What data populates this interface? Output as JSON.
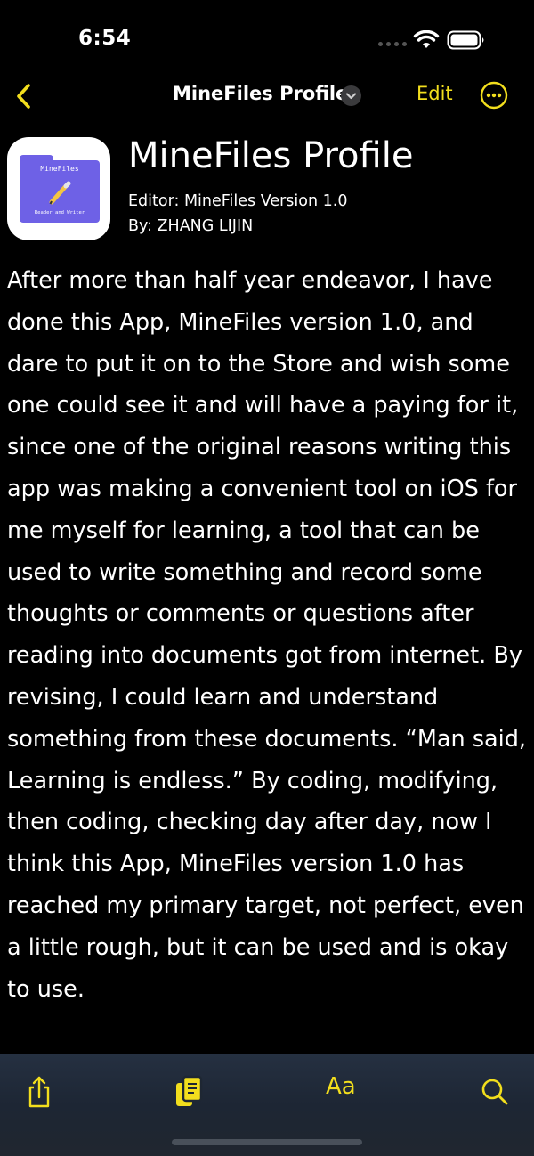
{
  "status": {
    "time": "6:54"
  },
  "nav": {
    "title": "MineFiles Profile",
    "edit_label": "Edit"
  },
  "document": {
    "app_icon": {
      "title": "MineFiles",
      "subtitle": "Reader and Writer"
    },
    "title": "MineFiles Profile",
    "editor_line": "Editor: MineFiles Version 1.0",
    "author_line": "By: ZHANG LIJIN",
    "body": "After more than half year endeavor, I have done this App, MineFiles version 1.0, and dare to put it on to the Store and wish some one could see it and will have a paying for it, since one of the original reasons writing this app was making a convenient tool on iOS for me myself for learning, a tool that can be used to write something and record some thoughts or comments or questions after reading into documents got from internet. By revising, I could learn and understand something from these documents. “Man said, Learning is endless.” By coding, modifying, then coding, checking day after day, now I think this App, MineFiles version 1.0 has reached my primary target, not perfect, even a little rough, but it can be used and is okay to use."
  },
  "toolbar": {
    "font_label": "Aa"
  },
  "icons": {
    "back": "chevron-left-icon",
    "title_menu": "chevron-down-circle-icon",
    "more": "ellipsis-circle-icon",
    "share": "share-icon",
    "copy": "copy-document-icon",
    "search": "magnifying-glass-icon",
    "wifi": "wifi-icon",
    "battery": "battery-icon",
    "signal": "signal-dots-icon"
  },
  "colors": {
    "accent": "#f2de1d",
    "background": "#000000",
    "toolbar": "#1f2733",
    "folder": "#6e61e6"
  }
}
